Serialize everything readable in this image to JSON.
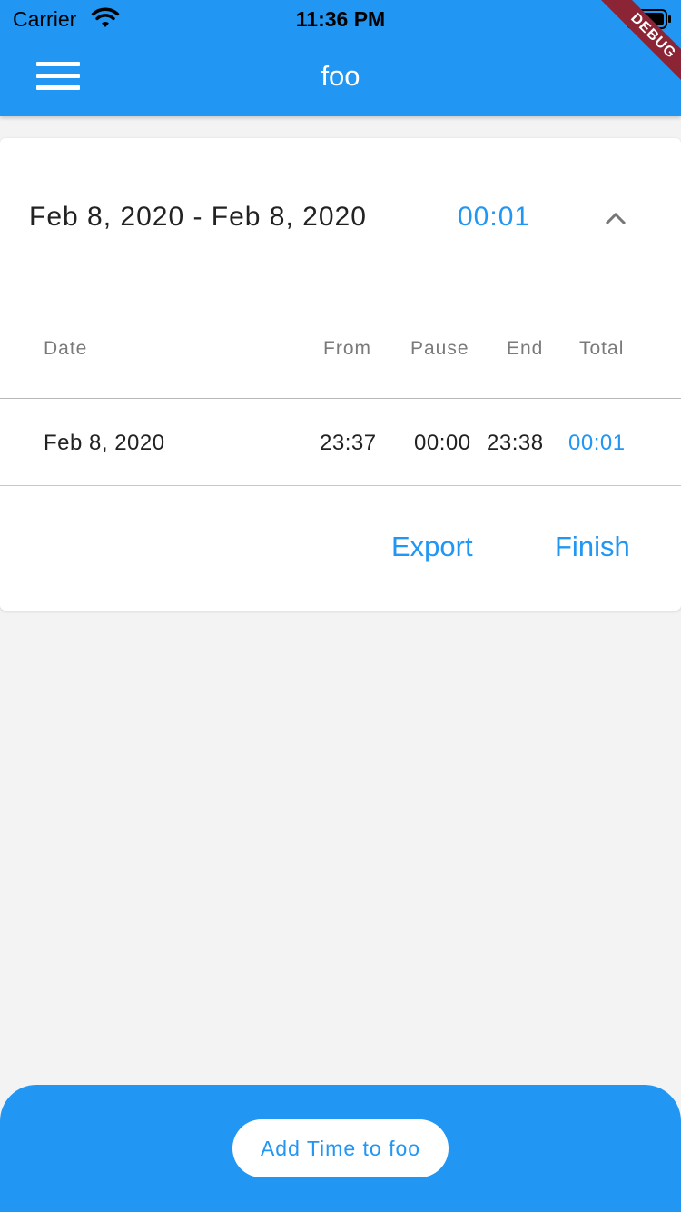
{
  "status_bar": {
    "carrier": "Carrier",
    "time": "11:36 PM"
  },
  "app_bar": {
    "title": "foo",
    "debug_label": "DEBUG"
  },
  "card": {
    "date_range": "Feb 8, 2020 - Feb 8, 2020",
    "range_total": "00:01",
    "columns": {
      "date": "Date",
      "from": "From",
      "pause": "Pause",
      "end": "End",
      "total": "Total"
    },
    "rows": [
      {
        "date": "Feb 8, 2020",
        "from": "23:37",
        "pause": "00:00",
        "end": "23:38",
        "total": "00:01"
      }
    ],
    "actions": {
      "export": "Export",
      "finish": "Finish"
    }
  },
  "bottom_bar": {
    "add_button_label": "Add Time to foo"
  },
  "colors": {
    "primary": "#2196f3",
    "background": "#f3f3f3",
    "card": "#ffffff",
    "debug_banner": "#8b2434"
  }
}
